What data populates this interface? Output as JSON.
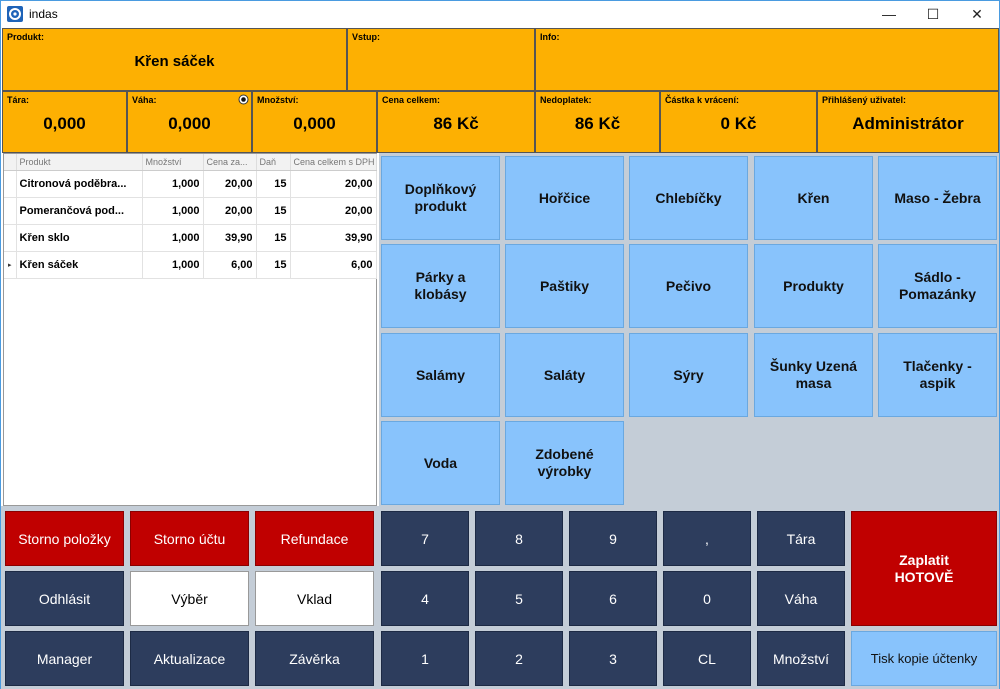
{
  "window": {
    "title": "indas",
    "minimize": "—",
    "maximize": "☐",
    "close": "✕"
  },
  "header": {
    "produkt_label": "Produkt:",
    "produkt_value": "Křen sáček",
    "vstup_label": "Vstup:",
    "vstup_value": "",
    "info_label": "Info:",
    "info_value": "",
    "tara_label": "Tára:",
    "tara_value": "0,000",
    "vaha_label": "Váha:",
    "vaha_value": "0,000",
    "mnozstvi_label": "Množství:",
    "mnozstvi_value": "0,000",
    "cena_label": "Cena celkem:",
    "cena_value": "86 Kč",
    "nedoplatek_label": "Nedoplatek:",
    "nedoplatek_value": "86 Kč",
    "vraceni_label": "Částka k vrácení:",
    "vraceni_value": "0 Kč",
    "uzivatel_label": "Přihlášený uživatel:",
    "uzivatel_value": "Administrátor"
  },
  "table": {
    "columns": [
      "Produkt",
      "Množství",
      "Cena za...",
      "Daň",
      "Cena celkem s DPH"
    ],
    "rows": [
      [
        "Citronová poděbra...",
        "1,000",
        "20,00",
        "15",
        "20,00"
      ],
      [
        "Pomerančová pod...",
        "1,000",
        "20,00",
        "15",
        "20,00"
      ],
      [
        "Křen sklo",
        "1,000",
        "39,90",
        "15",
        "39,90"
      ],
      [
        "Křen sáček",
        "1,000",
        "6,00",
        "15",
        "6,00"
      ]
    ],
    "current_row_marker": "▸"
  },
  "categories": [
    "Doplňkový produkt",
    "Hořčice",
    "Chlebíčky",
    "Křen",
    "Maso - Žebra",
    "Párky a klobásy",
    "Paštiky",
    "Pečivo",
    "Produkty",
    "Sádlo - Pomazánky",
    "Salámy",
    "Saláty",
    "Sýry",
    "Šunky Uzená masa",
    "Tlačenky - aspik",
    "Voda",
    "Zdobené výrobky"
  ],
  "actions": {
    "storno_polozky": "Storno položky",
    "storno_uctu": "Storno účtu",
    "refundace": "Refundace",
    "odhlasit": "Odhlásit",
    "vyber": "Výběr",
    "vklad": "Vklad",
    "manager": "Manager",
    "aktualizace": "Aktualizace",
    "zaverka": "Závěrka"
  },
  "keypad": {
    "k7": "7",
    "k8": "8",
    "k9": "9",
    "comma": ",",
    "tara": "Tára",
    "k4": "4",
    "k5": "5",
    "k6": "6",
    "k0": "0",
    "vaha": "Váha",
    "k1": "1",
    "k2": "2",
    "k3": "3",
    "cl": "CL",
    "mnozstvi": "Množství"
  },
  "pay": {
    "line1": "Zaplatit",
    "line2": "HOTOVĚ"
  },
  "tisk": "Tisk kopie účtenky"
}
